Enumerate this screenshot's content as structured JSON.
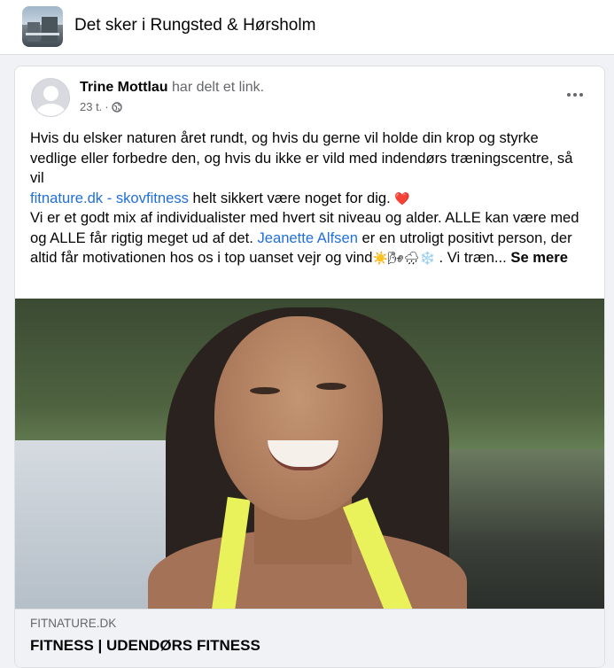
{
  "group": {
    "title": "Det sker i Rungsted & Hørsholm"
  },
  "post": {
    "author_name": "Trine Mottlau",
    "author_action": "har delt et link.",
    "timestamp": "23 t.",
    "separator": "·",
    "text": {
      "line1": "Hvis du elsker naturen året rundt, og hvis du gerne vil holde din krop og styrke vedlige eller forbedre den, og hvis du ikke er vild med indendørs træningscentre, så vil",
      "link1": "fitnature.dk - skovfitness",
      "line2_after_link": " helt sikkert være noget for dig. ",
      "heart": "❤️",
      "para2_before": "Vi er et godt mix af individualister med hvert sit niveau og alder. ALLE kan være med og ALLE får rigtig meget ud af det. ",
      "mention": "Jeanette Alfsen",
      "para2_after": " er en utroligt positivt person, der altid får motivationen hos os i top uanset vejr og vind",
      "weather_emojis": "☀️🌬🌧❄️",
      "para2_end": " . Vi træn... ",
      "see_more": "Se mere"
    }
  },
  "link_preview": {
    "domain": "FITNATURE.DK",
    "title": "FITNESS | UDENDØRS FITNESS"
  },
  "colors": {
    "link": "#216fdb",
    "muted": "#65676b",
    "accent_strap": "#e9f25a"
  },
  "icons": {
    "privacy": "globe-icon",
    "menu": "more-options-icon"
  }
}
